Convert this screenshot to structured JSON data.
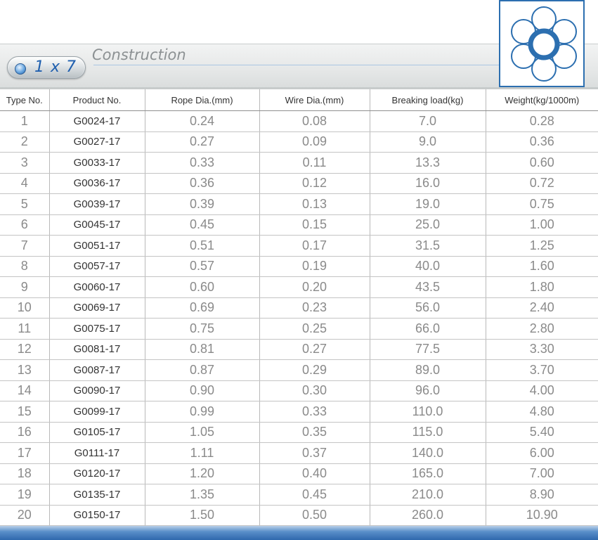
{
  "header": {
    "badge_label": "1 x 7",
    "title": "Construction"
  },
  "colors": {
    "accent_blue": "#2c6fb0",
    "header_grey": "#e6e8e8",
    "value_grey": "#8a8a8a"
  },
  "table": {
    "columns": [
      "Type No.",
      "Product No.",
      "Rope Dia.(mm)",
      "Wire Dia.(mm)",
      "Breaking load(kg)",
      "Weight(kg/1000m)"
    ],
    "rows": [
      [
        "1",
        "G0024-17",
        "0.24",
        "0.08",
        "7.0",
        "0.28"
      ],
      [
        "2",
        "G0027-17",
        "0.27",
        "0.09",
        "9.0",
        "0.36"
      ],
      [
        "3",
        "G0033-17",
        "0.33",
        "0.11",
        "13.3",
        "0.60"
      ],
      [
        "4",
        "G0036-17",
        "0.36",
        "0.12",
        "16.0",
        "0.72"
      ],
      [
        "5",
        "G0039-17",
        "0.39",
        "0.13",
        "19.0",
        "0.75"
      ],
      [
        "6",
        "G0045-17",
        "0.45",
        "0.15",
        "25.0",
        "1.00"
      ],
      [
        "7",
        "G0051-17",
        "0.51",
        "0.17",
        "31.5",
        "1.25"
      ],
      [
        "8",
        "G0057-17",
        "0.57",
        "0.19",
        "40.0",
        "1.60"
      ],
      [
        "9",
        "G0060-17",
        "0.60",
        "0.20",
        "43.5",
        "1.80"
      ],
      [
        "10",
        "G0069-17",
        "0.69",
        "0.23",
        "56.0",
        "2.40"
      ],
      [
        "11",
        "G0075-17",
        "0.75",
        "0.25",
        "66.0",
        "2.80"
      ],
      [
        "12",
        "G0081-17",
        "0.81",
        "0.27",
        "77.5",
        "3.30"
      ],
      [
        "13",
        "G0087-17",
        "0.87",
        "0.29",
        "89.0",
        "3.70"
      ],
      [
        "14",
        "G0090-17",
        "0.90",
        "0.30",
        "96.0",
        "4.00"
      ],
      [
        "15",
        "G0099-17",
        "0.99",
        "0.33",
        "110.0",
        "4.80"
      ],
      [
        "16",
        "G0105-17",
        "1.05",
        "0.35",
        "115.0",
        "5.40"
      ],
      [
        "17",
        "G0111-17",
        "1.11",
        "0.37",
        "140.0",
        "6.00"
      ],
      [
        "18",
        "G0120-17",
        "1.20",
        "0.40",
        "165.0",
        "7.00"
      ],
      [
        "19",
        "G0135-17",
        "1.35",
        "0.45",
        "210.0",
        "8.90"
      ],
      [
        "20",
        "G0150-17",
        "1.50",
        "0.50",
        "260.0",
        "10.90"
      ]
    ]
  }
}
